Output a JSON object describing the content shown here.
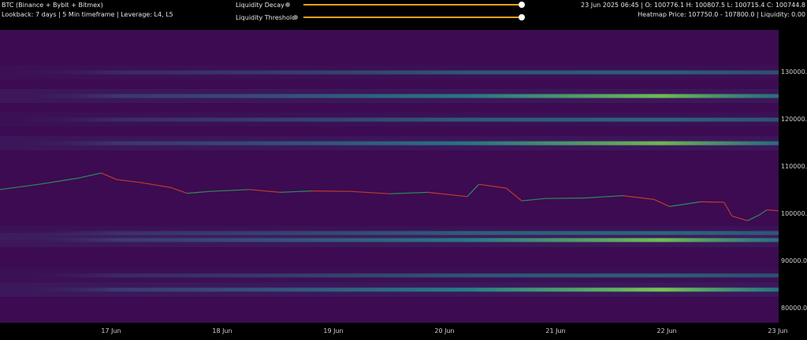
{
  "header": {
    "title": "BTC (Binance + Bybit + Bitmex)",
    "subtitle": "Lookback: 7 days | 5 Min timeframe | Leverage: L4, L5",
    "ohlc": "23 Jun 2025 06:45 | O: 100776.1 H: 100807.5 L: 100715.4 C: 100744.8",
    "heatmap_info": "Heatmap Price: 107750.0 - 107800.0 | Liquidity: 0.00"
  },
  "controls": {
    "decay": {
      "label": "Liquidity Decay",
      "icon": "info-icon",
      "value": 1.0
    },
    "threshold": {
      "label": "Liquidity Threshold",
      "icon": "info-icon",
      "value": 1.0
    }
  },
  "colors": {
    "background": "#3c0b52",
    "band_dark": "#3b5f8c",
    "band_mid": "#21908d",
    "band_hot": "#7ad151",
    "price_up": "#2e8b57",
    "price_down": "#c0392b",
    "slider": "#f0a020"
  },
  "chart_data": {
    "type": "heatmap",
    "title": "BTC (Binance + Bybit + Bitmex)",
    "y_ticks": [
      "130000.0",
      "120000.0",
      "110000.0",
      "100000.0",
      "90000.0",
      "80000.0"
    ],
    "x_ticks": [
      "17 Jun",
      "18 Jun",
      "19 Jun",
      "20 Jun",
      "21 Jun",
      "22 Jun",
      "23 Jun"
    ],
    "ylim": [
      77000,
      139000
    ],
    "liquidity_bands": [
      {
        "price": 130000,
        "intensity": 0.35
      },
      {
        "price": 125000,
        "intensity": 0.8
      },
      {
        "price": 120000,
        "intensity": 0.4
      },
      {
        "price": 115000,
        "intensity": 0.75
      },
      {
        "price": 96000,
        "intensity": 0.45
      },
      {
        "price": 94500,
        "intensity": 0.8
      },
      {
        "price": 87000,
        "intensity": 0.35
      },
      {
        "price": 84000,
        "intensity": 0.9
      }
    ],
    "price_series": [
      {
        "x": 0.0,
        "y": 105200
      },
      {
        "x": 0.05,
        "y": 106300
      },
      {
        "x": 0.1,
        "y": 107600
      },
      {
        "x": 0.13,
        "y": 108700
      },
      {
        "x": 0.15,
        "y": 107300
      },
      {
        "x": 0.18,
        "y": 106700
      },
      {
        "x": 0.22,
        "y": 105600
      },
      {
        "x": 0.24,
        "y": 104400
      },
      {
        "x": 0.27,
        "y": 104800
      },
      {
        "x": 0.32,
        "y": 105200
      },
      {
        "x": 0.36,
        "y": 104600
      },
      {
        "x": 0.4,
        "y": 104900
      },
      {
        "x": 0.45,
        "y": 104800
      },
      {
        "x": 0.5,
        "y": 104300
      },
      {
        "x": 0.55,
        "y": 104600
      },
      {
        "x": 0.6,
        "y": 103700
      },
      {
        "x": 0.615,
        "y": 106300
      },
      {
        "x": 0.65,
        "y": 105500
      },
      {
        "x": 0.67,
        "y": 102800
      },
      {
        "x": 0.7,
        "y": 103300
      },
      {
        "x": 0.75,
        "y": 103400
      },
      {
        "x": 0.8,
        "y": 103900
      },
      {
        "x": 0.84,
        "y": 103100
      },
      {
        "x": 0.86,
        "y": 101600
      },
      {
        "x": 0.9,
        "y": 102600
      },
      {
        "x": 0.93,
        "y": 102500
      },
      {
        "x": 0.94,
        "y": 99600
      },
      {
        "x": 0.96,
        "y": 98600
      },
      {
        "x": 0.975,
        "y": 99800
      },
      {
        "x": 0.985,
        "y": 100900
      },
      {
        "x": 1.0,
        "y": 100700
      }
    ]
  }
}
